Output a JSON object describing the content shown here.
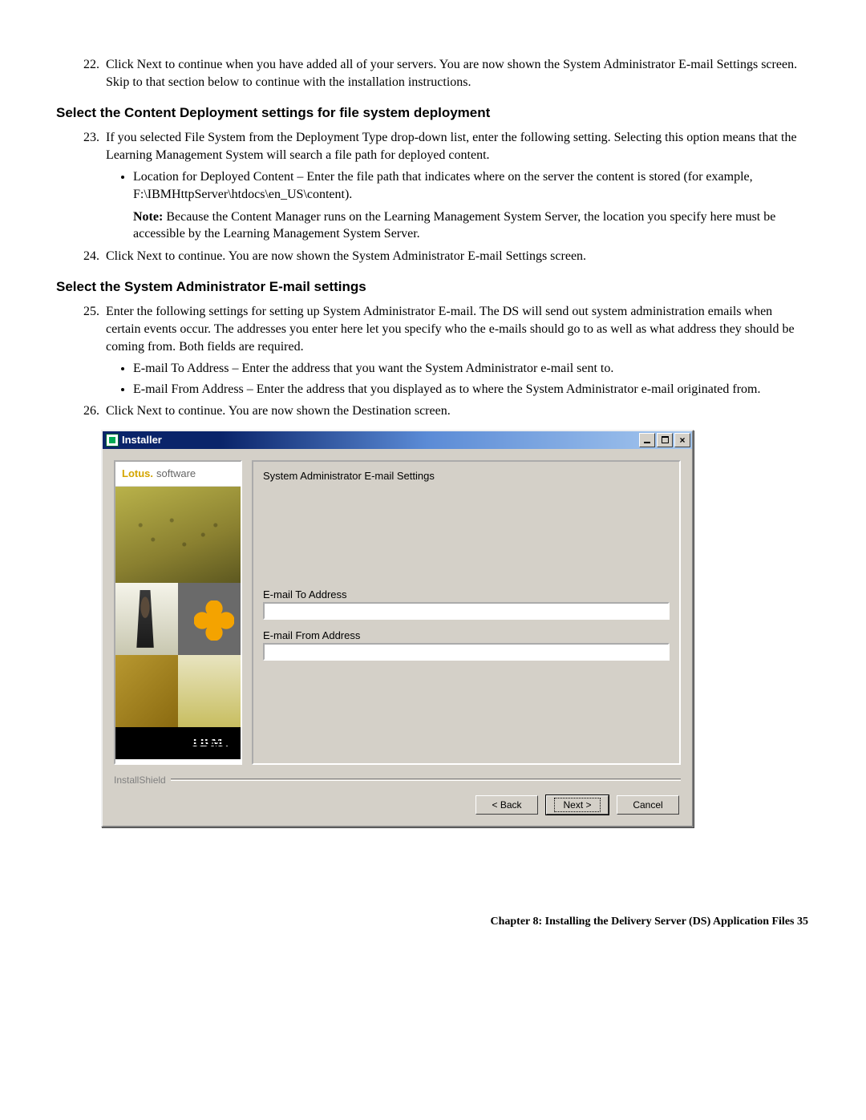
{
  "step22": {
    "num": "22",
    "text": "Click Next to continue when you have added all of your servers. You are now shown the System Administrator E-mail Settings screen. Skip to that section below to continue with the installation instructions."
  },
  "section1_heading": "Select the Content Deployment settings for file system deployment",
  "step23": {
    "num": "23",
    "intro": "If you selected File System from the Deployment Type drop-down list, enter the following setting. Selecting this option means that the Learning Management System will search a file path for deployed content.",
    "bullet": "Location for Deployed Content – Enter the file path that indicates where on the server the content is stored (for example, F:\\IBMHttpServer\\htdocs\\en_US\\content).",
    "note_label": "Note:",
    "note_text": " Because the Content Manager runs on the Learning Management System Server, the location you specify here must be accessible by the Learning Management System Server."
  },
  "step24": {
    "num": "24",
    "text": "Click Next to continue. You are now shown the System Administrator E-mail Settings screen."
  },
  "section2_heading": "Select the System Administrator E-mail settings",
  "step25": {
    "num": "25",
    "intro": "Enter the following settings for setting up System Administrator E-mail. The DS will send out system administration emails when certain events occur. The addresses you enter here let you specify who the e-mails should go to as well as what address they should be coming from. Both fields are required.",
    "bullet1": "E-mail To Address – Enter the address that you want the System Administrator e-mail sent to.",
    "bullet2": "E-mail From Address – Enter the address that you displayed as to where the System Administrator e-mail originated from."
  },
  "step26": {
    "num": "26",
    "text": "Click Next to continue. You are now shown the Destination screen."
  },
  "installer": {
    "title": "Installer",
    "brand_lotus": "Lotus.",
    "brand_software": "software",
    "ibm": "IBM.",
    "panel_heading": "System Administrator E-mail Settings",
    "label_to": "E-mail To Address",
    "value_to": "",
    "label_from": "E-mail From Address",
    "value_from": "",
    "installshield": "InstallShield",
    "btn_back": "< Back",
    "btn_next": "Next >",
    "btn_cancel": "Cancel"
  },
  "footer": "Chapter 8: Installing the Delivery Server (DS) Application Files 35"
}
